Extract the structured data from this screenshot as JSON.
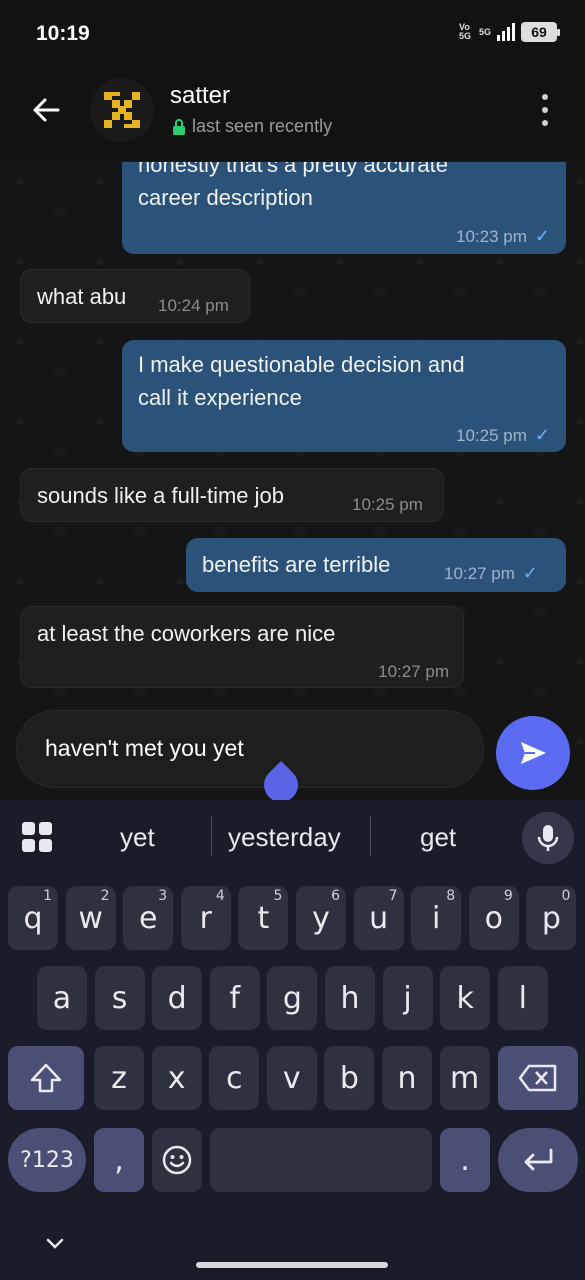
{
  "status_bar": {
    "time": "10:19",
    "network": "Vo 5G",
    "signal_label": "5G",
    "battery": "69"
  },
  "header": {
    "contact_name": "satter",
    "status": "last seen recently",
    "icons": {
      "back": "arrow-left-icon",
      "lock": "lock-icon",
      "menu": "kebab-menu-icon"
    }
  },
  "messages": [
    {
      "direction": "out",
      "text_line1": "honestly that's a pretty accurate",
      "text_line2": "career description",
      "time": "10:23 pm",
      "read": true
    },
    {
      "direction": "in",
      "text": "what abu",
      "time": "10:24 pm"
    },
    {
      "direction": "out",
      "text_line1": "I make questionable decision and",
      "text_line2": "call it experience",
      "time": "10:25 pm",
      "read": true
    },
    {
      "direction": "in",
      "text": "sounds like a full-time job",
      "time": "10:25 pm"
    },
    {
      "direction": "out",
      "text": "benefits are terrible",
      "time": "10:27 pm",
      "read": true
    },
    {
      "direction": "in",
      "text": "at least the coworkers are nice",
      "time": "10:27 pm"
    }
  ],
  "composer": {
    "value": "haven't met you yet",
    "send_icon": "send-icon"
  },
  "keyboard": {
    "suggestions": [
      "yet",
      "yesterday",
      "get"
    ],
    "row1": [
      {
        "k": "q",
        "h": "1"
      },
      {
        "k": "w",
        "h": "2"
      },
      {
        "k": "e",
        "h": "3"
      },
      {
        "k": "r",
        "h": "4"
      },
      {
        "k": "t",
        "h": "5"
      },
      {
        "k": "y",
        "h": "6"
      },
      {
        "k": "u",
        "h": "7"
      },
      {
        "k": "i",
        "h": "8"
      },
      {
        "k": "o",
        "h": "9"
      },
      {
        "k": "p",
        "h": "0"
      }
    ],
    "row2": [
      "a",
      "s",
      "d",
      "f",
      "g",
      "h",
      "j",
      "k",
      "l"
    ],
    "row3": [
      "z",
      "x",
      "c",
      "v",
      "b",
      "n",
      "m"
    ],
    "symbols_label": "?123",
    "comma": ",",
    "period": "."
  }
}
